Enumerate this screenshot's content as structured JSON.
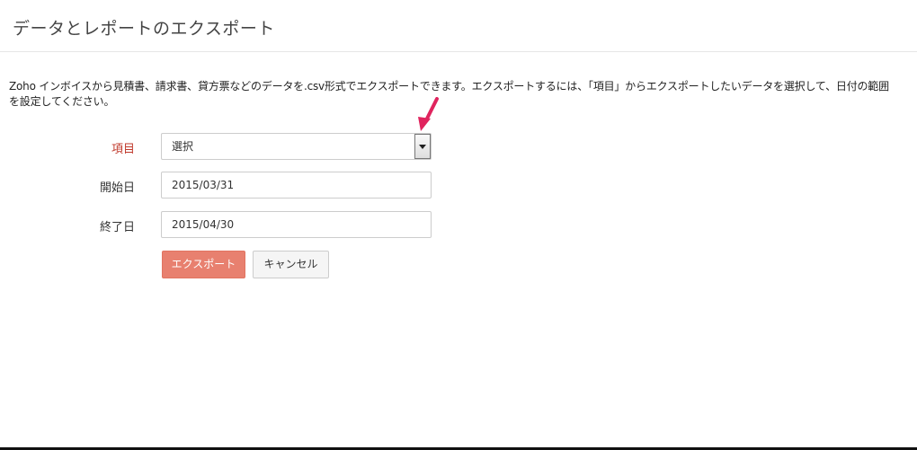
{
  "header": {
    "title": "データとレポートのエクスポート"
  },
  "description": "Zoho インボイスから見積書、請求書、貸方票などのデータを.csv形式でエクスポートできます。エクスポートするには、「項目」からエクスポートしたいデータを選択して、日付の範囲を設定してください。",
  "form": {
    "item": {
      "label": "項目",
      "selected": "選択"
    },
    "start_date": {
      "label": "開始日",
      "value": "2015/03/31"
    },
    "end_date": {
      "label": "終了日",
      "value": "2015/04/30"
    }
  },
  "buttons": {
    "export_label": "エクスポート",
    "cancel_label": "キャンセル"
  },
  "colors": {
    "required_label": "#c0392b",
    "primary_button": "#e8806f",
    "annotation_arrow": "#e0245e"
  },
  "icons": {
    "dropdown": "chevron-down-icon",
    "annotation": "arrow-pointer-icon"
  }
}
